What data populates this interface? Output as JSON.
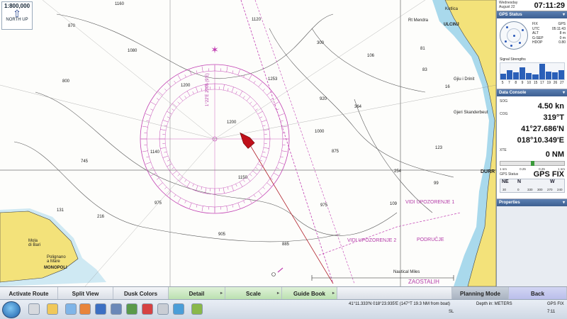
{
  "chart": {
    "scale_ratio": "1:800,000",
    "north_up": "NORTH UP",
    "depths": [
      "1160",
      "870",
      "1080",
      "800",
      "1200",
      "1150",
      "1140",
      "745",
      "975",
      "216",
      "131",
      "905",
      "975",
      "1253",
      "920",
      "106",
      "300",
      "364",
      "1000",
      "1120",
      "1200",
      "885",
      "875",
      "254",
      "109",
      "99",
      "123",
      "81",
      "83",
      "16"
    ],
    "places": {
      "kotlica": "Kotlica",
      "ulcinj": "ULCINJ",
      "rt_mendra": "Rt Mendra",
      "gjiu": "Gjiu i Drinit",
      "shkembi": "Gjeri Skanderbeut",
      "durres": "DURR",
      "mola": "Mola\ndi Bari",
      "polignano": "Polignano\na Mare",
      "monopoli": "MONOPOLI",
      "nautical": "Nautical Miles",
      "zaostalih": "ZAOSTALIH",
      "podrucje": "PODRUČJE",
      "vidi1": "VIDI UPOZORENJE 1",
      "vidi2": "VIDI UPOZORENJE 2",
      "compass_var": "1°22'E 2006 (9'E)"
    }
  },
  "panel": {
    "day": "Wednesday",
    "date": "August 22",
    "time": "07:11:29",
    "gps_status_title": "GPS Status",
    "gps_rows": [
      {
        "k": "FIX",
        "v": "GPS"
      },
      {
        "k": "UTC",
        "v": "05:11:43"
      },
      {
        "k": "ALT",
        "v": "8 m"
      },
      {
        "k": "G-SEP",
        "v": "0 m"
      },
      {
        "k": "HDOP",
        "v": "0.80"
      }
    ],
    "signal_title": "Signal Strengths",
    "signal": [
      {
        "prn": "5",
        "level": 0.35
      },
      {
        "prn": "7",
        "level": 0.55
      },
      {
        "prn": "8",
        "level": 0.45
      },
      {
        "prn": "9",
        "level": 0.75
      },
      {
        "prn": "10",
        "level": 0.4
      },
      {
        "prn": "15",
        "level": 0.3
      },
      {
        "prn": "17",
        "level": 0.95
      },
      {
        "prn": "19",
        "level": 0.5
      },
      {
        "prn": "26",
        "level": 0.45
      },
      {
        "prn": "27",
        "level": 0.55
      }
    ],
    "data_console_title": "Data Console",
    "sog_label": "SOG",
    "sog": "4.50 kn",
    "cog_label": "COG",
    "cog": "319°T",
    "lat": "41°27.686'N",
    "lon": "018°10.349'E",
    "xte_label": "XTE",
    "xte": "0 NM",
    "xte_scale": [
      "1 nm",
      "0.25",
      "0.25",
      "1 nm"
    ],
    "gps_status_label": "GPS Status",
    "gps_status": "GPS FIX",
    "heading_dirs": [
      "NE",
      "N",
      "W"
    ],
    "heading_degs": [
      "30",
      "0",
      "330",
      "300",
      "270",
      "240"
    ],
    "properties_title": "Properties"
  },
  "toolbar": {
    "activate_route": "Activate Route",
    "split_view": "Split View",
    "dusk_colors": "Dusk Colors",
    "detail": "Detail",
    "scale": "Scale",
    "guide_book": "Guide Book",
    "planning_mode": "Planning Mode",
    "back": "Back"
  },
  "status": {
    "coord": "41°11.333'N  018°23.935'E  (147°T 19.3 NM from boat)",
    "depth": "Depth in: METERS",
    "gps": "GPS FIX",
    "tray": "SL",
    "clock": "7:11"
  },
  "colors": {
    "land": "#f3e27a",
    "shallow": "#a9d9ec",
    "magenta": "#c13fb2",
    "boat": "#c0101a"
  }
}
